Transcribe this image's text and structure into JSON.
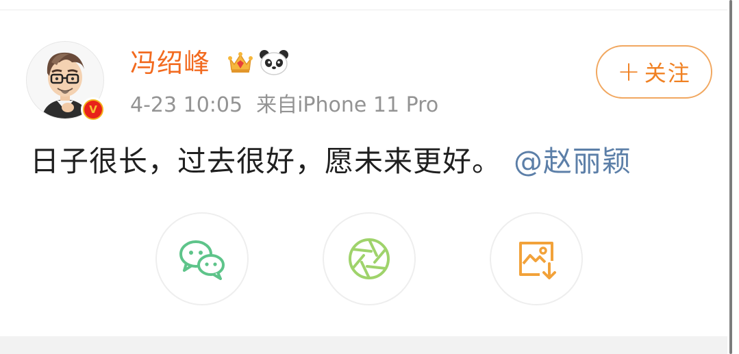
{
  "user": {
    "name": "冯绍峰",
    "badge_letter": "V"
  },
  "meta": {
    "timestamp": "4-23 10:05",
    "source": "来自iPhone 11 Pro"
  },
  "follow_button": {
    "plus": "+",
    "label": "关注"
  },
  "post": {
    "text": "日子很长，过去很好，愿未来更好。",
    "mention": "@赵丽颖"
  },
  "share": {
    "buttons": [
      {
        "icon": "wechat-icon"
      },
      {
        "icon": "moments-icon"
      },
      {
        "icon": "save-image-icon"
      }
    ]
  },
  "colors": {
    "username": "#f26a1f",
    "follow_border": "#f1a75f",
    "follow_text": "#f08123",
    "mention": "#5c7fa8",
    "meta": "#939393",
    "wechat": "#5ec48a",
    "moments": "#9fd36b",
    "save": "#f2a23a"
  }
}
